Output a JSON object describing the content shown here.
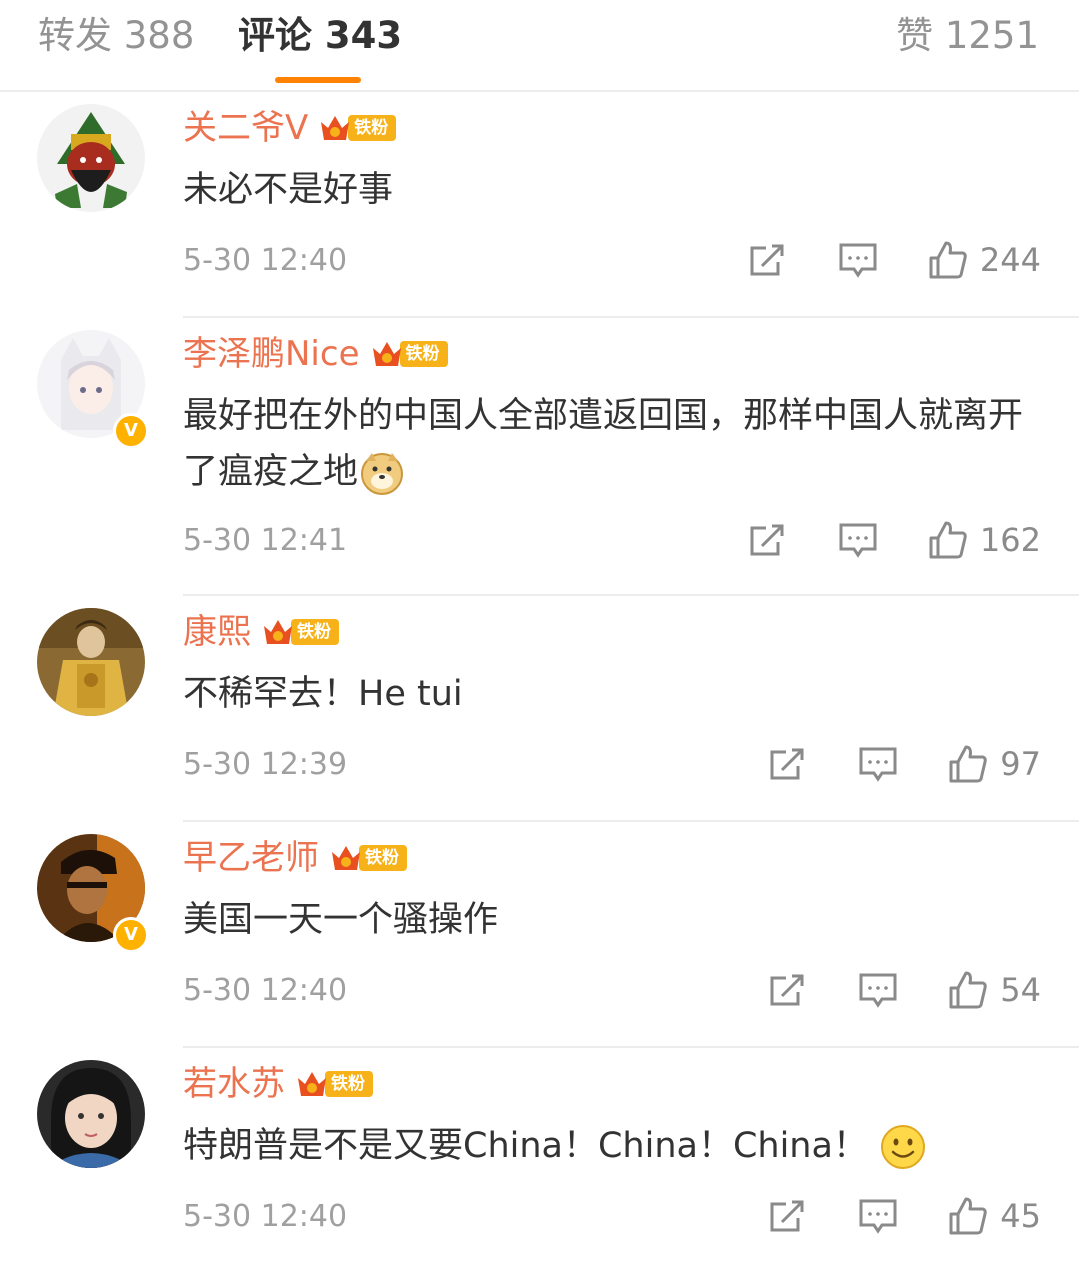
{
  "tabs": {
    "repost": "转发 388",
    "comments": "评论 343",
    "likes": "赞 1251"
  },
  "badge_label": "铁粉",
  "verified_mark": "V",
  "colors": {
    "accent": "#ff8200",
    "username": "#eb7350",
    "badge": "#f7b21a",
    "verified": "#ffb100"
  },
  "comments": [
    {
      "username": "关二爷V",
      "text": "未必不是好事",
      "emoji": null,
      "time": "5-30 12:40",
      "likes": "244",
      "verified": false,
      "avatar": "guan-yu-avatar"
    },
    {
      "username": "李泽鹏Nice",
      "text": "最好把在外的中国人全部遣返回国，那样中国人就离开了瘟疫之地",
      "emoji": "doge-emoji",
      "time": "5-30 12:41",
      "likes": "162",
      "verified": true,
      "avatar": "anime-boy-avatar"
    },
    {
      "username": "康熙",
      "text": "不稀罕去！He tui",
      "emoji": null,
      "time": "5-30 12:39",
      "likes": "97",
      "verified": false,
      "avatar": "emperor-avatar"
    },
    {
      "username": "早乙老师",
      "text": "美国一天一个骚操作",
      "emoji": null,
      "time": "5-30 12:40",
      "likes": "54",
      "verified": true,
      "avatar": "dark-portrait-avatar"
    },
    {
      "username": "若水苏",
      "text": "特朗普是不是又要China！China！China！",
      "emoji": "smile-emoji",
      "time": "5-30 12:40",
      "likes": "45",
      "verified": false,
      "avatar": "girl-avatar"
    }
  ]
}
